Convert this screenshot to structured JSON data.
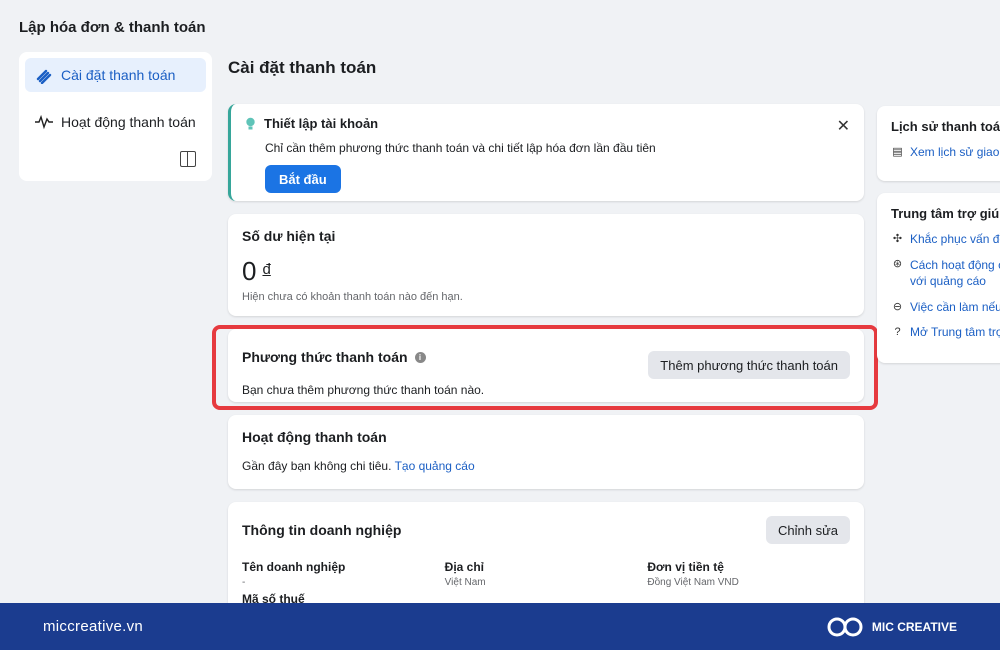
{
  "app": {
    "title": "Lập hóa đơn & thanh toán"
  },
  "sidebar": {
    "items": [
      {
        "label": "Cài đặt thanh toán",
        "active": true
      },
      {
        "label": "Hoạt động thanh toán",
        "active": false
      }
    ]
  },
  "page": {
    "title": "Cài đặt thanh toán"
  },
  "setup": {
    "title": "Thiết lập tài khoản",
    "body": "Chỉ cần thêm phương thức thanh toán và chi tiết lập hóa đơn lần đầu tiên",
    "button": "Bắt đầu"
  },
  "balance": {
    "title": "Số dư hiện tại",
    "amount": "0",
    "currency": "đ",
    "note": "Hiện chưa có khoản thanh toán nào đến hạn."
  },
  "payment_methods": {
    "title": "Phương thức thanh toán",
    "button": "Thêm phương thức thanh toán",
    "body": "Bạn chưa thêm phương thức thanh toán nào."
  },
  "activity": {
    "title": "Hoạt động thanh toán",
    "body": "Gần đây bạn không chi tiêu.",
    "link": "Tạo quảng cáo"
  },
  "business": {
    "title": "Thông tin doanh nghiệp",
    "button": "Chỉnh sửa",
    "fields": [
      {
        "label": "Tên doanh nghiệp",
        "value": "-"
      },
      {
        "label": "Địa chỉ",
        "value": "Việt Nam"
      },
      {
        "label": "Đơn vị tiền tệ",
        "value": "Đồng Việt Nam VND"
      }
    ],
    "tax_label": "Mã số thuế"
  },
  "right_panel": {
    "history": {
      "title": "Lịch sử thanh toán",
      "link": "Xem lịch sử giao d"
    },
    "help": {
      "title": "Trung tâm trợ giúp",
      "links": [
        {
          "line1": "Khắc phục vấn đề",
          "line2": ""
        },
        {
          "line1": "Cách hoạt động c",
          "line2": "với quảng cáo"
        },
        {
          "line1": "Việc cần làm nếu",
          "line2": ""
        },
        {
          "line1": "Mở Trung tâm trợ",
          "line2": ""
        }
      ]
    }
  },
  "footer": {
    "site": "miccreative.vn",
    "brand": "MIC CREATIVE"
  },
  "colors": {
    "accent": "#1b74e4",
    "highlight": "#e63a3f",
    "footer_bg": "#1b3c8f",
    "setup_border": "#36a69a"
  }
}
